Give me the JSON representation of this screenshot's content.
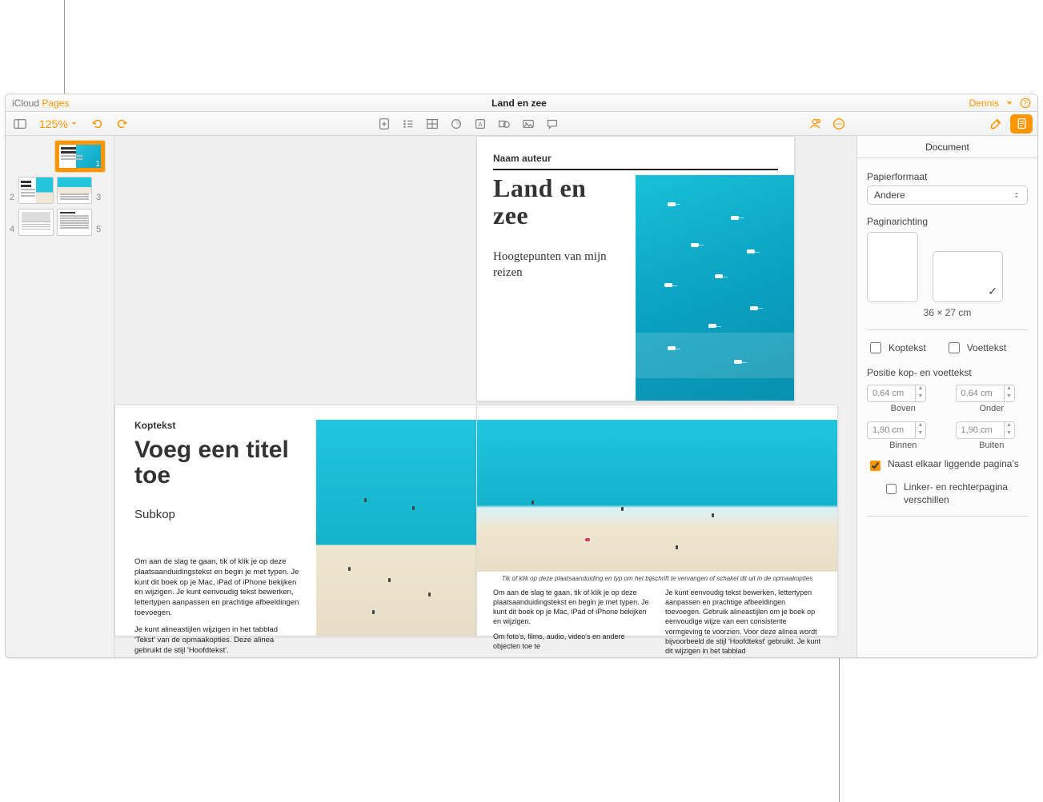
{
  "titlebar": {
    "brand_icloud": "iCloud",
    "brand_pages": "Pages",
    "doc_title": "Land en zee",
    "user": "Dennis"
  },
  "toolbar": {
    "zoom": "125%"
  },
  "thumbnails": {
    "nums": [
      "1",
      "2",
      "3",
      "4",
      "5"
    ]
  },
  "page1": {
    "author": "Naam auteur",
    "title_l1": "Land en",
    "title_l2": "zee",
    "subtitle": "Hoogtepunten van mijn reizen"
  },
  "page2": {
    "kop": "Koptekst",
    "title": "Voeg een titel toe",
    "sub": "Subkop",
    "body_p1": "Om aan de slag te gaan, tik of klik je op deze plaatsaanduidingstekst en begin je met typen. Je kunt dit boek op je Mac, iPad of iPhone bekijken en wijzigen. Je kunt eenvoudig tekst bewerken, lettertypen aanpassen en prachtige afbeeldingen toevoegen.",
    "body_p2": "Je kunt alineastijlen wijzigen in het tabblad 'Tekst' van de opmaakopties. Deze alinea gebruikt de stijl 'Hoofdtekst'."
  },
  "page3": {
    "caption": "Tik of klik op deze plaatsaanduiding en typ om het bijschrift te vervangen of schakel dit uit in de opmaakopties",
    "col1_p1": "Om aan de slag te gaan, tik of klik je op deze plaatsaanduidingstekst en begin je met typen. Je kunt dit boek op je Mac, iPad of iPhone bekijken en wijzigen.",
    "col1_p2": "Om foto's, films, audio, video's en andere objecten toe te",
    "col2_p1": "Je kunt eenvoudig tekst bewerken, lettertypen aanpassen en prachtige afbeeldingen toevoegen. Gebruik alineastijlen om je boek op eenvoudige wijze van een consistente vormgeving te voorzien. Voor deze alinea wordt bijvoorbeeld de stijl 'Hoofdtekst' gebruikt. Je kunt dit wijzigen in het tabblad"
  },
  "inspector": {
    "tab": "Document",
    "paper_label": "Papierformaat",
    "paper_value": "Andere",
    "orient_label": "Paginarichting",
    "orient_dim": "36 × 27 cm",
    "header_label": "Koptekst",
    "footer_label": "Voettekst",
    "hf_pos_label": "Positie kop- en voettekst",
    "hf_top_val": "0,64 cm",
    "hf_top_cap": "Boven",
    "hf_bot_val": "0,64 cm",
    "hf_bot_cap": "Onder",
    "hf_in_val": "1,90 cm",
    "hf_in_cap": "Binnen",
    "hf_out_val": "1,90 cm",
    "hf_out_cap": "Buiten",
    "facing_label": "Naast elkaar liggende pagina's",
    "diff_label": "Linker- en rechterpagina verschillen"
  }
}
